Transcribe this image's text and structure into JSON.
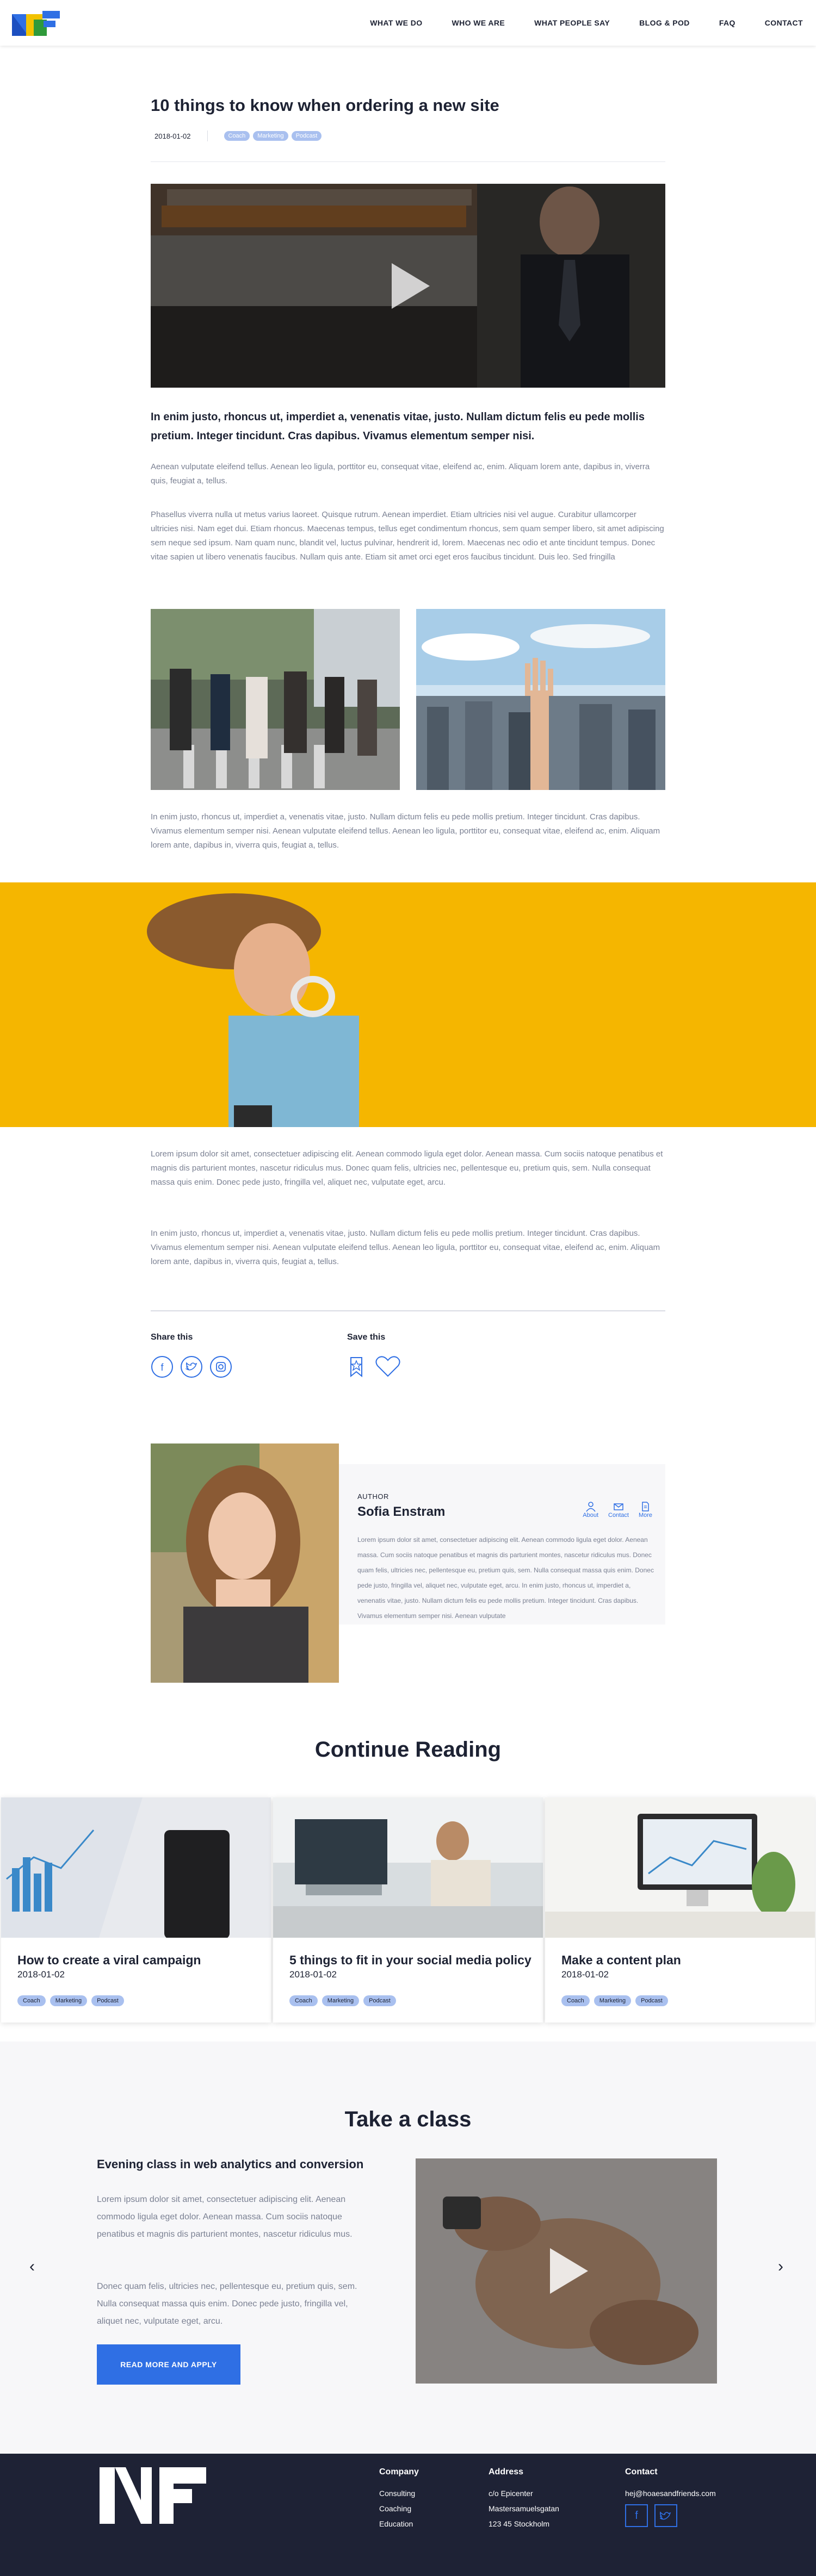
{
  "brand": {
    "accent": "#2f6fe4",
    "dark": "#1e2235",
    "tag_bg": "#a9c0ef",
    "banner_yellow": "#f5b600"
  },
  "header": {
    "nav": [
      "WHAT WE DO",
      "WHO WE ARE",
      "WHAT PEOPLE SAY",
      "BLOG & POD",
      "FAQ",
      "CONTACT"
    ]
  },
  "article": {
    "title": "10 things to know when ordering a new site",
    "date": "2018-01-02",
    "tags": [
      "Coach",
      "Marketing",
      "Podcast"
    ],
    "lead": "In enim justo, rhoncus ut, imperdiet a, venenatis vitae, justo. Nullam dictum felis eu pede mollis pretium. Integer tincidunt. Cras dapibus. Vivamus elementum semper nisi.",
    "p1": "Aenean vulputate eleifend tellus. Aenean leo ligula, porttitor eu, consequat vitae, eleifend ac, enim. Aliquam lorem ante, dapibus in, viverra quis, feugiat a, tellus.",
    "p2": "Phasellus viverra nulla ut metus varius laoreet. Quisque rutrum. Aenean imperdiet. Etiam ultricies nisi vel augue. Curabitur ullamcorper ultricies nisi. Nam eget dui. Etiam rhoncus. Maecenas tempus, tellus eget condimentum rhoncus, sem quam semper libero, sit amet adipiscing sem neque sed ipsum. Nam quam nunc, blandit vel, luctus pulvinar, hendrerit id, lorem. Maecenas nec odio et ante tincidunt tempus. Donec vitae sapien ut libero venenatis faucibus. Nullam quis ante. Etiam sit amet orci eget eros faucibus tincidunt. Duis leo. Sed fringilla",
    "p3": "In enim justo, rhoncus ut, imperdiet a, venenatis vitae, justo. Nullam dictum felis eu pede mollis pretium. Integer tincidunt. Cras dapibus. Vivamus elementum semper nisi. Aenean vulputate eleifend tellus. Aenean leo ligula, porttitor eu, consequat vitae, eleifend ac, enim. Aliquam lorem ante, dapibus in, viverra quis, feugiat a, tellus.",
    "p4": "Lorem ipsum dolor sit amet, consectetuer adipiscing elit. Aenean commodo ligula eget dolor. Aenean massa. Cum sociis natoque penatibus et magnis dis parturient montes, nascetur ridiculus mus. Donec quam felis, ultricies nec, pellentesque eu, pretium quis, sem. Nulla consequat massa quis enim. Donec pede justo, fringilla vel, aliquet nec, vulputate eget, arcu.",
    "p5": "In enim justo, rhoncus ut, imperdiet a, venenatis vitae, justo. Nullam dictum felis eu pede mollis pretium. Integer tincidunt. Cras dapibus. Vivamus elementum semper nisi. Aenean vulputate eleifend tellus. Aenean leo ligula, porttitor eu, consequat vitae, eleifend ac, enim. Aliquam lorem ante, dapibus in, viverra quis, feugiat a, tellus.",
    "share_label": "Share this",
    "save_label": "Save this"
  },
  "author": {
    "kicker": "AUTHOR",
    "name": "Sofia Enstram",
    "actions": [
      "About",
      "Contact",
      "More"
    ],
    "bio": "Lorem ipsum dolor sit amet, consectetuer adipiscing elit. Aenean commodo ligula eget dolor. Aenean massa. Cum sociis natoque penatibus et magnis dis parturient montes, nascetur ridiculus mus. Donec quam felis, ultricies nec, pellentesque eu, pretium quis, sem. Nulla consequat massa quis enim. Donec pede justo, fringilla vel, aliquet nec, vulputate eget, arcu. In enim justo, rhoncus ut, imperdiet a, venenatis vitae, justo. Nullam dictum felis eu pede mollis pretium. Integer tincidunt. Cras dapibus. Vivamus elementum semper nisi. Aenean vulputate"
  },
  "continue": {
    "title": "Continue Reading",
    "cards": [
      {
        "title": "How to create a viral campaign",
        "date": "2018-01-02",
        "tags": [
          "Coach",
          "Marketing",
          "Podcast"
        ]
      },
      {
        "title": "5 things to fit in your social media policy",
        "date": "2018-01-02",
        "tags": [
          "Coach",
          "Marketing",
          "Podcast"
        ]
      },
      {
        "title": "Make a content plan",
        "date": "2018-01-02",
        "tags": [
          "Coach",
          "Marketing",
          "Podcast"
        ]
      }
    ]
  },
  "class": {
    "section_title": "Take a class",
    "heading": "Evening class in web analytics and conversion",
    "p1": "Lorem ipsum dolor sit amet, consectetuer adipiscing elit. Aenean commodo ligula eget dolor. Aenean massa. Cum sociis natoque penatibus et magnis dis parturient montes, nascetur ridiculus mus.",
    "p2": "Donec quam felis, ultricies nec, pellentesque eu, pretium quis, sem. Nulla consequat massa quis enim. Donec pede justo, fringilla vel, aliquet nec, vulputate eget, arcu.",
    "button": "READ MORE AND APPLY",
    "prev": "‹",
    "next": "›"
  },
  "footer": {
    "company": {
      "title": "Company",
      "items": [
        "Consulting",
        "Coaching",
        "Education"
      ]
    },
    "address": {
      "title": "Address",
      "lines": [
        "c/o Epicenter",
        "Mastersamuelsgatan",
        "123 45 Stockholm"
      ]
    },
    "contact": {
      "title": "Contact",
      "email": "hej@hoaesandfriends.com"
    }
  }
}
